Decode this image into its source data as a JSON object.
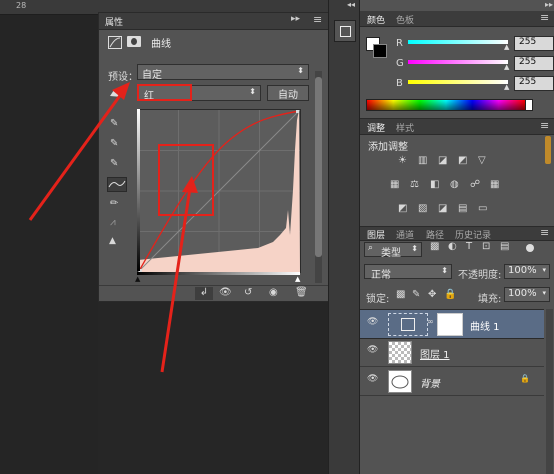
{
  "ruler": {
    "tick_label": "28"
  },
  "properties": {
    "tab_title": "属性",
    "panel_title": "曲线",
    "preset_label": "预设：",
    "preset_value": "自定",
    "channel_value": "红",
    "auto_button": "自动"
  },
  "color_panel": {
    "tabs": [
      "颜色",
      "色板"
    ],
    "channels": [
      {
        "label": "R",
        "value": "255"
      },
      {
        "label": "G",
        "value": "255"
      },
      {
        "label": "B",
        "value": "255"
      }
    ]
  },
  "adjustments": {
    "tabs": [
      "调整",
      "样式"
    ],
    "title": "添加调整"
  },
  "layers": {
    "tabs": [
      "图层",
      "通道",
      "路径",
      "历史记录"
    ],
    "filter_label": "类型",
    "blend_mode": "正常",
    "opacity_label": "不透明度:",
    "opacity_value": "100%",
    "lock_label": "锁定:",
    "fill_label": "填充:",
    "fill_value": "100%",
    "items": [
      {
        "name": "曲线 1"
      },
      {
        "name": "图层 1"
      },
      {
        "name": "背景"
      }
    ]
  },
  "colors": {
    "accent_red": "#e4221a",
    "panel_bg": "#535353",
    "selected_layer_bg": "#5a6c86"
  }
}
